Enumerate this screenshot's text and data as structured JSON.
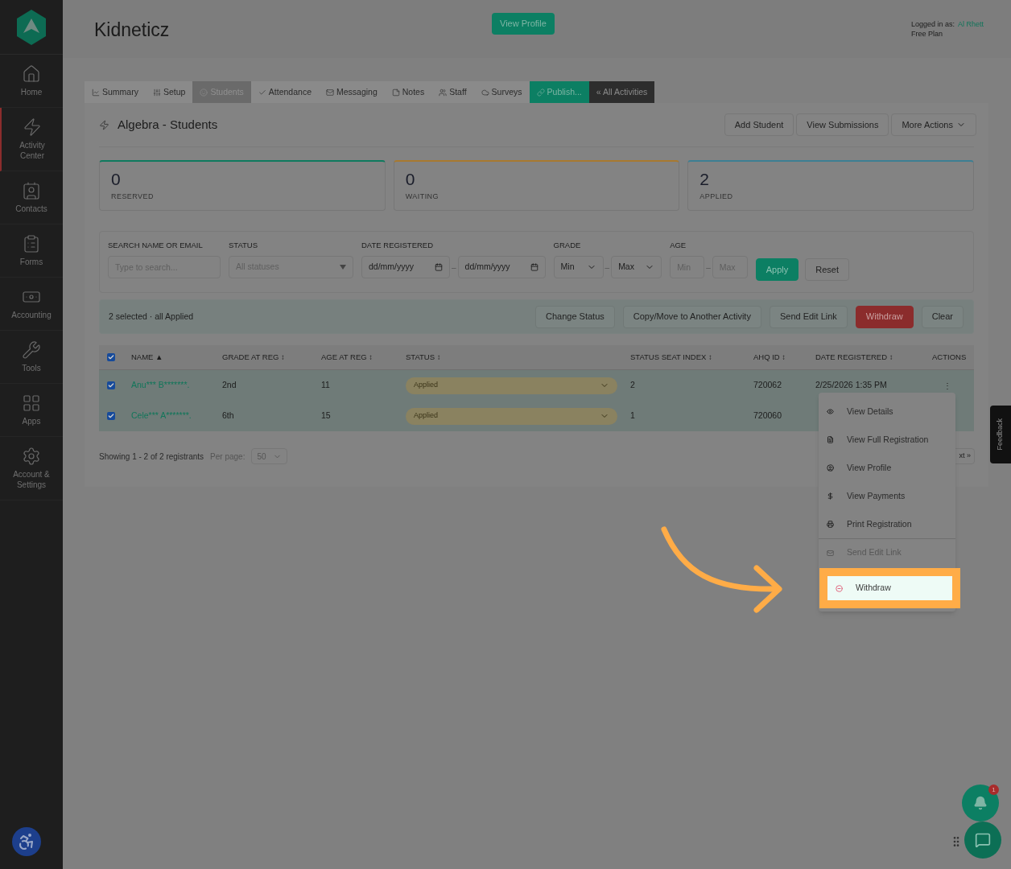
{
  "sidebar": {
    "items": [
      {
        "label": "Home",
        "selected": false
      },
      {
        "label": "Activity Center",
        "selected": true
      },
      {
        "label": "Contacts",
        "selected": false
      },
      {
        "label": "Forms",
        "selected": false
      },
      {
        "label": "Accounting",
        "selected": false
      },
      {
        "label": "Tools",
        "selected": false
      },
      {
        "label": "Apps",
        "selected": false
      },
      {
        "label": "Account & Settings",
        "selected": false
      }
    ]
  },
  "header": {
    "title": "Kidneticz",
    "view_profile": "View Profile",
    "logged_in_label": "Logged in as:",
    "user": "Al Rhett",
    "plan": "Free Plan"
  },
  "tabs": [
    {
      "label": "Summary",
      "kind": "tab",
      "selected": false
    },
    {
      "label": "Setup",
      "kind": "tab",
      "selected": false
    },
    {
      "label": "Students",
      "kind": "tab",
      "selected": true
    },
    {
      "label": "Attendance",
      "kind": "tab",
      "selected": false
    },
    {
      "label": "Messaging",
      "kind": "tab",
      "selected": false
    },
    {
      "label": "Notes",
      "kind": "tab",
      "selected": false
    },
    {
      "label": "Staff",
      "kind": "tab",
      "selected": false
    },
    {
      "label": "Surveys",
      "kind": "tab",
      "selected": false
    },
    {
      "label": "Publish...",
      "kind": "publish",
      "selected": false
    },
    {
      "label": "« All Activities",
      "kind": "back",
      "selected": false
    }
  ],
  "page": {
    "title": "Algebra - Students",
    "actions": [
      "Add Student",
      "View Submissions",
      "More Actions"
    ]
  },
  "stats": [
    {
      "value": "0",
      "label": "RESERVED",
      "color": "#0f7a5e"
    },
    {
      "value": "0",
      "label": "WAITING",
      "color": "#a8792f"
    },
    {
      "value": "2",
      "label": "APPLIED",
      "color": "#3d7f93"
    }
  ],
  "filters": {
    "search_label": "SEARCH NAME OR EMAIL",
    "search_placeholder": "Type to search...",
    "status_label": "STATUS",
    "status_value": "All statuses",
    "date_label": "DATE REGISTERED",
    "date_from": "dd/mm/yyyy",
    "date_to": "dd/mm/yyyy",
    "grade_label": "GRADE",
    "grade_min": "Min",
    "grade_max": "Max",
    "age_label": "AGE",
    "age_min_placeholder": "Min",
    "age_max_placeholder": "Max",
    "separator": "–",
    "apply": "Apply",
    "reset": "Reset"
  },
  "bulk": {
    "summary": "2 selected · all Applied",
    "buttons": [
      {
        "label": "Change Status",
        "kind": "plain"
      },
      {
        "label": "Copy/Move to Another Activity",
        "kind": "plain"
      },
      {
        "label": "Send Edit Link",
        "kind": "plain"
      },
      {
        "label": "Withdraw",
        "kind": "danger"
      },
      {
        "label": "Clear",
        "kind": "plain"
      }
    ]
  },
  "table": {
    "all_checked": true,
    "columns": [
      "NAME ▲",
      "GRADE AT REG ↕",
      "AGE AT REG ↕",
      "STATUS ↕",
      "STATUS SEAT INDEX ↕",
      "AHQ ID ↕",
      "DATE REGISTERED ↕",
      "ACTIONS"
    ],
    "rows": [
      {
        "checked": true,
        "name": "Anu*** B*******.",
        "grade": "2nd",
        "age": "11",
        "status": "Applied",
        "seat": "2",
        "ahq_id": "720062",
        "date": "2/25/2026 1:35 PM",
        "actions": "⋮"
      },
      {
        "checked": true,
        "name": "Cele*** A*******.",
        "grade": "6th",
        "age": "15",
        "status": "Applied",
        "seat": "1",
        "ahq_id": "720060"
      }
    ]
  },
  "footer": {
    "showing": "Showing 1 - 2 of 2 registrants",
    "per_page_label": "Per page:",
    "per_page": "50",
    "next": "xt »"
  },
  "menu": {
    "items": [
      {
        "label": "View Details",
        "disabled": false,
        "highlighted": false,
        "divider_before": false
      },
      {
        "label": "View Full Registration",
        "disabled": false,
        "highlighted": false,
        "divider_before": false
      },
      {
        "label": "View Profile",
        "disabled": false,
        "highlighted": false,
        "divider_before": false
      },
      {
        "label": "View Payments",
        "disabled": false,
        "highlighted": false,
        "divider_before": false
      },
      {
        "label": "Print Registration",
        "disabled": false,
        "highlighted": false,
        "divider_before": false
      },
      {
        "label": "Send Edit Link",
        "disabled": true,
        "highlighted": false,
        "divider_before": true
      },
      {
        "label": "Withdraw",
        "disabled": false,
        "highlighted": true,
        "divider_before": false
      }
    ]
  },
  "feedback": "Feedback",
  "notifications": {
    "count": "1"
  }
}
